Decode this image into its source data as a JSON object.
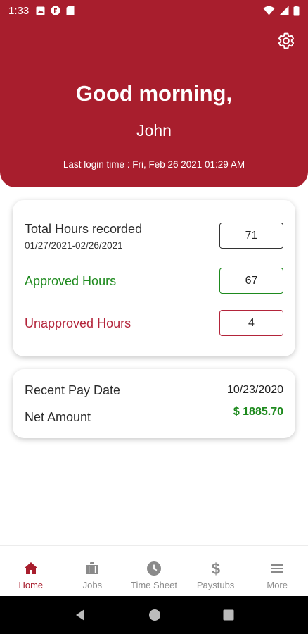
{
  "status_bar": {
    "time": "1:33"
  },
  "header": {
    "greeting": "Good morning,",
    "user_name": "John",
    "last_login": "Last login time : Fri, Feb 26 2021 01:29 AM",
    "background_color": "#a81e2d"
  },
  "hours_card": {
    "total_label": "Total Hours recorded",
    "date_range": "01/27/2021-02/26/2021",
    "total_value": "71",
    "approved_label": "Approved Hours",
    "approved_value": "67",
    "approved_color": "#1e8a1e",
    "unapproved_label": "Unapproved Hours",
    "unapproved_value": "4",
    "unapproved_color": "#b3243a"
  },
  "pay_card": {
    "recent_pay_label": "Recent Pay Date",
    "recent_pay_date": "10/23/2020",
    "net_amount_label": "Net Amount",
    "net_amount_value": "$ 1885.70",
    "amount_color": "#1e8a1e"
  },
  "bottom_nav": {
    "items": [
      {
        "label": "Home",
        "icon": "home-icon",
        "active": true
      },
      {
        "label": "Jobs",
        "icon": "briefcase-icon",
        "active": false
      },
      {
        "label": "Time Sheet",
        "icon": "clock-icon",
        "active": false
      },
      {
        "label": "Paystubs",
        "icon": "dollar-icon",
        "active": false
      },
      {
        "label": "More",
        "icon": "menu-icon",
        "active": false
      }
    ]
  }
}
